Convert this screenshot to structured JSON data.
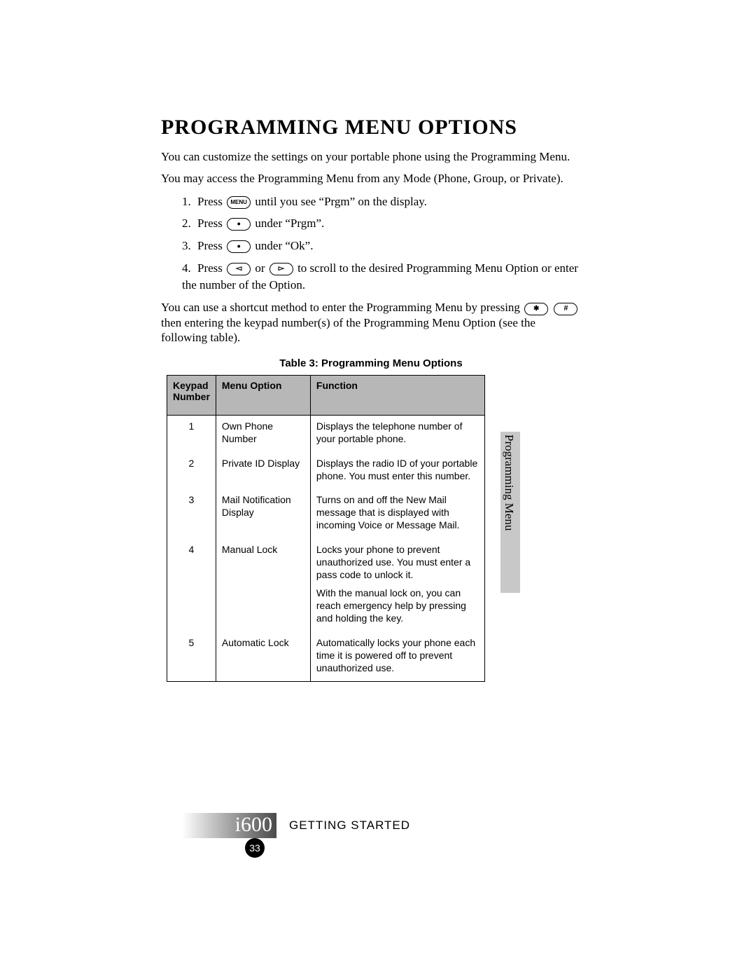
{
  "heading": "PROGRAMMING MENU OPTIONS",
  "intro1": "You can customize the settings on your portable phone using the Programming Menu.",
  "intro2": "You may access the Programming Menu from any Mode (Phone, Group, or Private).",
  "steps": {
    "s1a": "Press ",
    "s1b": " until you see “Prgm” on the display.",
    "s2a": "Press ",
    "s2b": " under “Prgm”.",
    "s3a": "Press ",
    "s3b": " under “Ok”.",
    "s4a": "Press ",
    "s4b": " or ",
    "s4c": " to scroll to the desired Programming Menu Option or enter the number of the Option."
  },
  "shortcut_a": "You can use a shortcut method to enter the Programming Menu by pressing ",
  "shortcut_b": " then entering the keypad number(s) of the Programming Menu Option (see the following table).",
  "key_menu_label": "MENU",
  "table_caption": "Table 3: Programming Menu Options",
  "table": {
    "h1": "Keypad Number",
    "h2": "Menu Option",
    "h3": "Function",
    "rows": [
      {
        "num": "1",
        "opt": "Own Phone Number",
        "func": "Displays the telephone number of your portable phone."
      },
      {
        "num": "2",
        "opt": "Private ID Display",
        "func": "Displays the radio ID of your portable phone. You must enter this number."
      },
      {
        "num": "3",
        "opt": "Mail Notification Display",
        "func": "Turns on and off the New Mail message that is displayed with incoming Voice or Message Mail."
      },
      {
        "num": "4",
        "opt": "Manual Lock",
        "func": "Locks your phone to prevent unauthorized use. You must enter a pass code to unlock it.",
        "func2": "With the manual lock on, you can reach emergency help by pressing and holding the key."
      },
      {
        "num": "5",
        "opt": "Automatic Lock",
        "func": "Automatically locks your phone each time it is powered off to prevent unauthorized use."
      }
    ]
  },
  "side_tab": "Programming Menu",
  "footer": {
    "model": "i600",
    "section": "GETTING STARTED",
    "page": "33"
  }
}
